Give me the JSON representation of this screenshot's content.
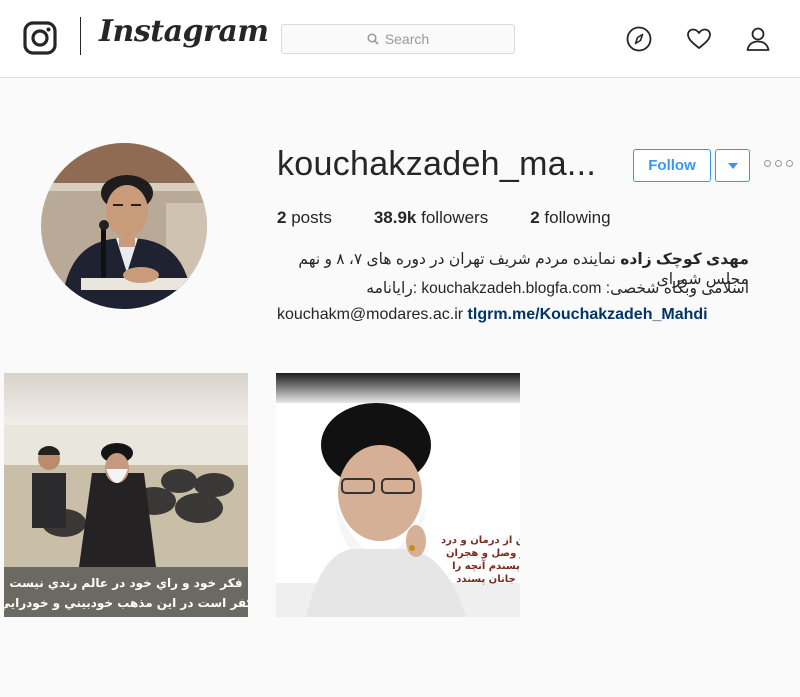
{
  "header": {
    "brand": "Instagram",
    "search": {
      "placeholder": "Search"
    },
    "icons": [
      "instagram-logo-icon",
      "explore-compass-icon",
      "activity-heart-icon",
      "profile-user-icon"
    ]
  },
  "profile": {
    "username": "kouchakzadeh_ma...",
    "follow_label": "Follow",
    "stats": {
      "posts_count": "2",
      "posts_label": "posts",
      "followers_count": "38.9k",
      "followers_label": "followers",
      "following_count": "2",
      "following_label": "following"
    },
    "bio": {
      "name": "مهدی کوچک زاده",
      "line1_rest": " نماینده مردم شریف تهران در دوره های ۷، ۸ و نهم مجلس شورای",
      "line2": "اسلامی وبگاه شخصی: kouchakzadeh.blogfa.com :رایانامه",
      "email": "kouchakm@modares.ac.ir",
      "link": "tlgrm.me/Kouchakzadeh_Mahdi"
    }
  },
  "posts": [
    {
      "caption_line1": "فكر خود و راي خود در عالم رندي نيست",
      "caption_line2": "كفر است در اين مذهب خودبيني و خودرايي"
    },
    {
      "caption_lines": [
        "من از درمان و درد",
        "و وصل و هجران",
        "پسندم آنچه را",
        "جانان پسندد"
      ]
    }
  ],
  "colors": {
    "accent": "#3897f0",
    "link": "#003569",
    "text": "#262626",
    "border": "#dbdbdb"
  }
}
